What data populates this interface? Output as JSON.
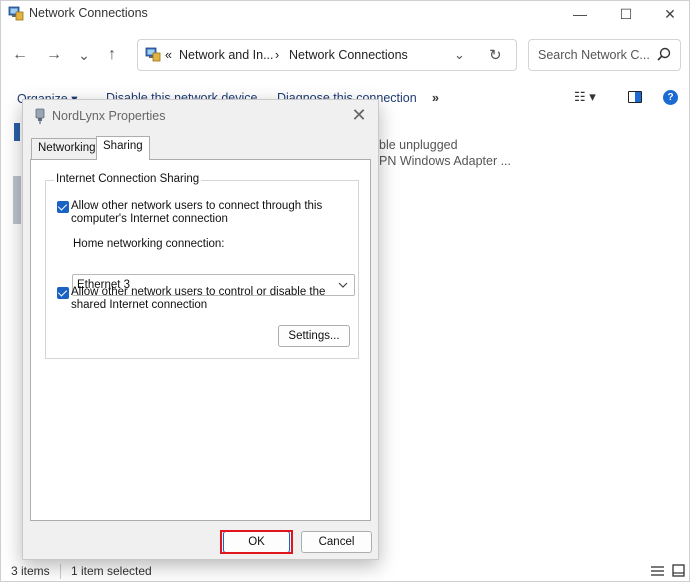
{
  "window": {
    "title": "Network Connections",
    "controls": {
      "minimize": "—",
      "maximize": "☐",
      "close": "✕"
    }
  },
  "address_bar": {
    "nav": {
      "back": "←",
      "forward": "→",
      "recent": "⌄",
      "up": "↑"
    },
    "chevrons": "«",
    "crumbs": [
      "Network and In...",
      "Network Connections"
    ],
    "separator": "›",
    "dropdown": "⌄",
    "refresh": "↻",
    "search_placeholder": "Search Network C..."
  },
  "command_bar": {
    "items": [
      "Organize ▾",
      "Disable this network device",
      "Diagnose this connection"
    ],
    "more": "»",
    "view_icon": "☷ ▾"
  },
  "background_list": {
    "line1": "ble unplugged",
    "line2": "PN Windows Adapter ..."
  },
  "status_bar": {
    "items_count": "3 items",
    "selected": "1 item selected"
  },
  "dialog": {
    "title": "NordLynx Properties",
    "close": "✕",
    "tabs": [
      "Networking",
      "Sharing"
    ],
    "active_tab": "Sharing",
    "group_label": "Internet Connection Sharing",
    "checkbox1": {
      "checked": true,
      "line1": "Allow other network users to connect through this",
      "line2": "computer's Internet connection"
    },
    "home_label": "Home networking connection:",
    "home_value": "Ethernet 3",
    "checkbox2": {
      "checked": true,
      "line1": "Allow other network users to control or disable the",
      "line2": "shared Internet connection"
    },
    "settings_button": "Settings...",
    "ok_button": "OK",
    "cancel_button": "Cancel"
  },
  "colors": {
    "accent": "#1b62c5",
    "highlight": "#e0161c",
    "help": "#1c6bd3"
  }
}
